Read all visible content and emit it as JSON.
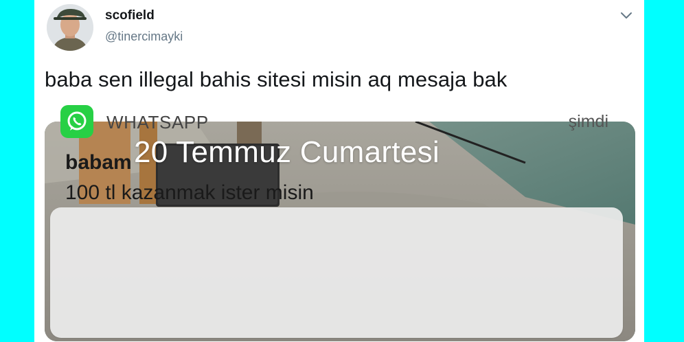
{
  "tweet": {
    "author_name": "scofield",
    "author_handle": "@tinercimayki",
    "text": "baba sen illegal bahis sitesi misin aq mesaja bak"
  },
  "media": {
    "lockscreen_date": "20 Temmuz Cumartesi",
    "notification": {
      "app_name": "WHATSAPP",
      "time": "şimdi",
      "sender": "babam",
      "message": "100 tl kazanmak ister misin",
      "icon": "whatsapp-icon",
      "icon_color": "#27D045"
    }
  },
  "colors": {
    "page_background": "#00FFFF",
    "card_background": "#FFFFFF",
    "handle_text": "#657786"
  }
}
